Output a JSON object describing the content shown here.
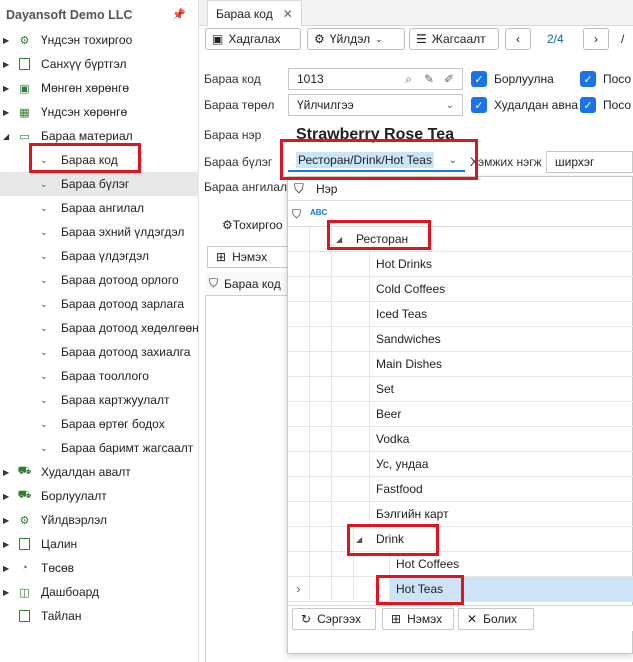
{
  "app": {
    "title": "Dayansoft Demo LLC"
  },
  "sidebar": {
    "items": [
      {
        "label": "Үндсэн тохиргоо",
        "icon": "gear-icon",
        "glyph": "⚙"
      },
      {
        "label": "Санхүү бүртгэл",
        "icon": "ledger-icon",
        "glyph": "▤"
      },
      {
        "label": "Мөнгөн хөрөнгө",
        "icon": "money-icon",
        "glyph": "▣"
      },
      {
        "label": "Үндсэн хөрөнгө",
        "icon": "building-icon",
        "glyph": "▦"
      },
      {
        "label": "Бараа материал",
        "icon": "box-icon",
        "glyph": "▭"
      }
    ],
    "children": [
      "Бараа код",
      "Бараа бүлэг",
      "Бараа ангилал",
      "Бараа эхний үлдэгдэл",
      "Бараа үлдэгдэл",
      "Бараа дотоод орлого",
      "Бараа дотоод зарлага",
      "Бараа дотоод хөдөлгөөн",
      "Бараа дотоод захиалга",
      "Бараа тооллого",
      "Бараа картжуулалт",
      "Бараа өртөг бодох",
      "Бараа баримт жагсаалт"
    ],
    "items_after": [
      {
        "label": "Худалдан авалт",
        "icon": "cart-icon",
        "glyph": "🛒"
      },
      {
        "label": "Борлуулалт",
        "icon": "sales-cart-icon",
        "glyph": "🛒"
      },
      {
        "label": "Үйлдвэрлэл",
        "icon": "factory-icon",
        "glyph": "⚙"
      },
      {
        "label": "Цалин",
        "icon": "calculator-icon",
        "glyph": "▦"
      },
      {
        "label": "Төсөв",
        "icon": "pie-icon",
        "glyph": "◔"
      },
      {
        "label": "Дашбоард",
        "icon": "dashboard-icon",
        "glyph": "◫"
      },
      {
        "label": "Тайлан",
        "icon": "report-icon",
        "glyph": "▯"
      }
    ]
  },
  "tab": {
    "label": "Бараа код",
    "close": "✕"
  },
  "toolbar": {
    "save": "Хадгалах",
    "actions": "Үйлдэл",
    "list": "Жагсаалт",
    "page": "2/4",
    "slash": "/"
  },
  "form": {
    "code_label": "Бараа код",
    "code_value": "1013",
    "type_label": "Бараа төрөл",
    "type_value": "Үйлчилгээ",
    "name_label": "Бараа нэр",
    "name_value": "Strawberry Rose Tea",
    "group_label": "Бараа бүлэг",
    "group_value": "Ресторан/Drink/Hot Teas",
    "category_label": "Бараа ангилал",
    "unit_label": "Хэмжих нэгж",
    "unit_value": "ширхэг",
    "chk_sales": "Борлуулна",
    "chk_purchase": "Худалдан авна",
    "chk_pos1": "Посо",
    "chk_pos2": "Посо"
  },
  "subpanel": {
    "tab": "Тохиргоо",
    "add": "Нэмэх",
    "column": "Бараа код"
  },
  "popup": {
    "header": "Нэр",
    "root": "Ресторан",
    "items": [
      "Hot Drinks",
      "Cold Coffees",
      "Iced Teas",
      "Sandwiches",
      "Main Dishes",
      "Set",
      "Beer",
      "Vodka",
      "Ус, ундаа",
      "Fastfood",
      "Бэлгийн карт"
    ],
    "drink": "Drink",
    "drink_children": [
      "Hot Coffees",
      "Hot Teas"
    ],
    "footer": {
      "refresh": "Сэргээх",
      "add": "Нэмэх",
      "cancel": "Болих"
    }
  },
  "colors": {
    "accent": "#1a73e8",
    "highlight": "#e0141e",
    "selected_row": "#cce4f7"
  }
}
